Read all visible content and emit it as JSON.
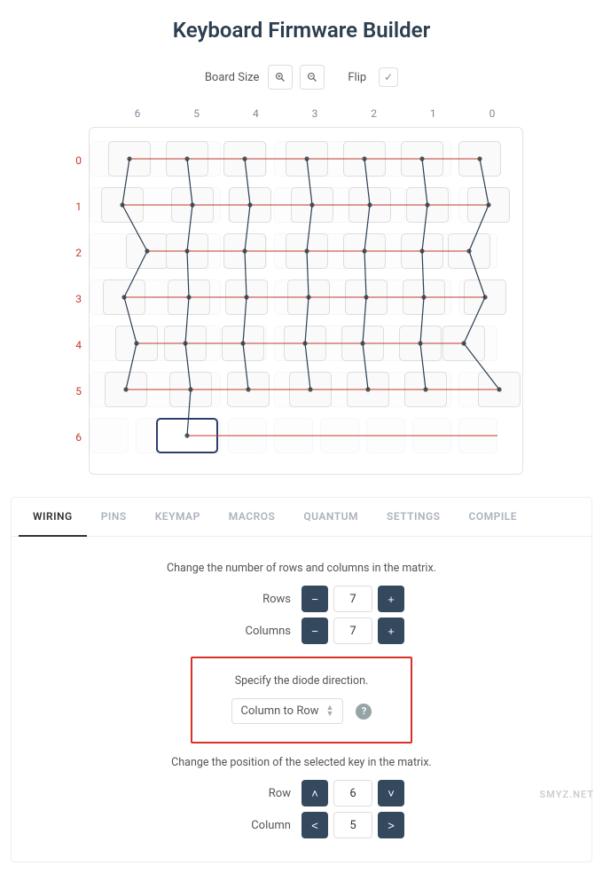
{
  "title": "Keyboard Firmware Builder",
  "toolbar": {
    "board_size_label": "Board Size",
    "flip_label": "Flip",
    "flip_checked": true
  },
  "matrix": {
    "col_labels": [
      "6",
      "5",
      "4",
      "3",
      "2",
      "1",
      "0"
    ],
    "row_labels": [
      "0",
      "1",
      "2",
      "3",
      "4",
      "5",
      "6"
    ],
    "selected": {
      "row": 6,
      "col": 5
    }
  },
  "tabs": [
    {
      "id": "wiring",
      "label": "WIRING",
      "active": true
    },
    {
      "id": "pins",
      "label": "PINS",
      "active": false
    },
    {
      "id": "keymap",
      "label": "KEYMAP",
      "active": false
    },
    {
      "id": "macros",
      "label": "MACROS",
      "active": false
    },
    {
      "id": "quantum",
      "label": "QUANTUM",
      "active": false
    },
    {
      "id": "settings",
      "label": "SETTINGS",
      "active": false
    },
    {
      "id": "compile",
      "label": "COMPILE",
      "active": false
    }
  ],
  "wiring": {
    "rows_cols_instruction": "Change the number of rows and columns in the matrix.",
    "rows_label": "Rows",
    "rows_value": "7",
    "cols_label": "Columns",
    "cols_value": "7",
    "diode_instruction": "Specify the diode direction.",
    "diode_value": "Column to Row",
    "position_instruction": "Change the position of the selected key in the matrix.",
    "row_label": "Row",
    "row_value": "6",
    "col_label": "Column",
    "col_value": "5"
  },
  "watermark": "SMYZ.NET",
  "chart_data": {
    "type": "diagram",
    "description": "Keyboard wiring matrix: 7 columns (labeled 6..0, right-to-left numbering shown left-to-right) × 7 rows (0..6). Red horizontal wires connect keys in each row; dark vertical/diagonal wires connect keys in each column. Row 6 has a single selected key near column 5. Nodes mark each key center.",
    "columns": 7,
    "rows": 7,
    "row_wires_color": "#c0392b",
    "col_wires_color": "#2c3e50"
  }
}
